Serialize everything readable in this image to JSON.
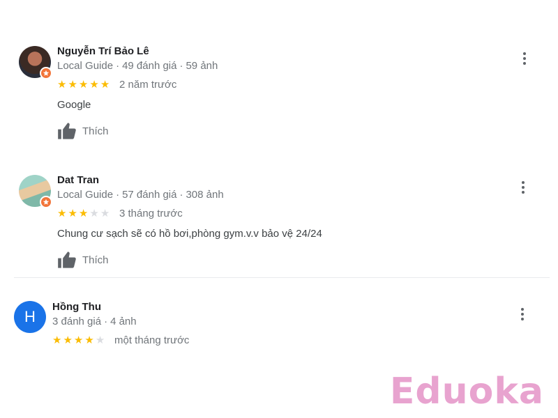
{
  "reviews": [
    {
      "name": "Nguyễn Trí Bảo Lê",
      "meta_role": "Local Guide",
      "meta_reviews": "49 đánh giá",
      "meta_photos": "59 ảnh",
      "rating": 5,
      "time": "2 năm trước",
      "text": "Google",
      "like_label": "Thích",
      "avatar": "photo",
      "local_guide_badge": true
    },
    {
      "name": "Dat Tran",
      "meta_role": "Local Guide",
      "meta_reviews": "57 đánh giá",
      "meta_photos": "308 ảnh",
      "rating": 3,
      "time": "3 tháng trước",
      "text": "Chung cư sạch sẽ có hồ bơi,phòng gym.v.v bảo vệ 24/24",
      "like_label": "Thích",
      "avatar": "photo",
      "local_guide_badge": true
    },
    {
      "name": "Hồng Thu",
      "meta_reviews": "3 đánh giá",
      "meta_photos": "4 ảnh",
      "rating": 4,
      "time": "một tháng trước",
      "avatar": "letter",
      "avatar_letter": "H",
      "avatar_color": "#1a73e8"
    }
  ],
  "icons": {
    "star": "star-icon",
    "like": "thumbs-up-icon",
    "more": "more-vert-icon",
    "badge": "local-guide-badge-icon"
  },
  "colors": {
    "star_on": "#fbbc04",
    "star_off": "#dadce0",
    "badge": "#f2753a",
    "watermark": "#e8a3cf"
  },
  "watermark": "Eduoka"
}
